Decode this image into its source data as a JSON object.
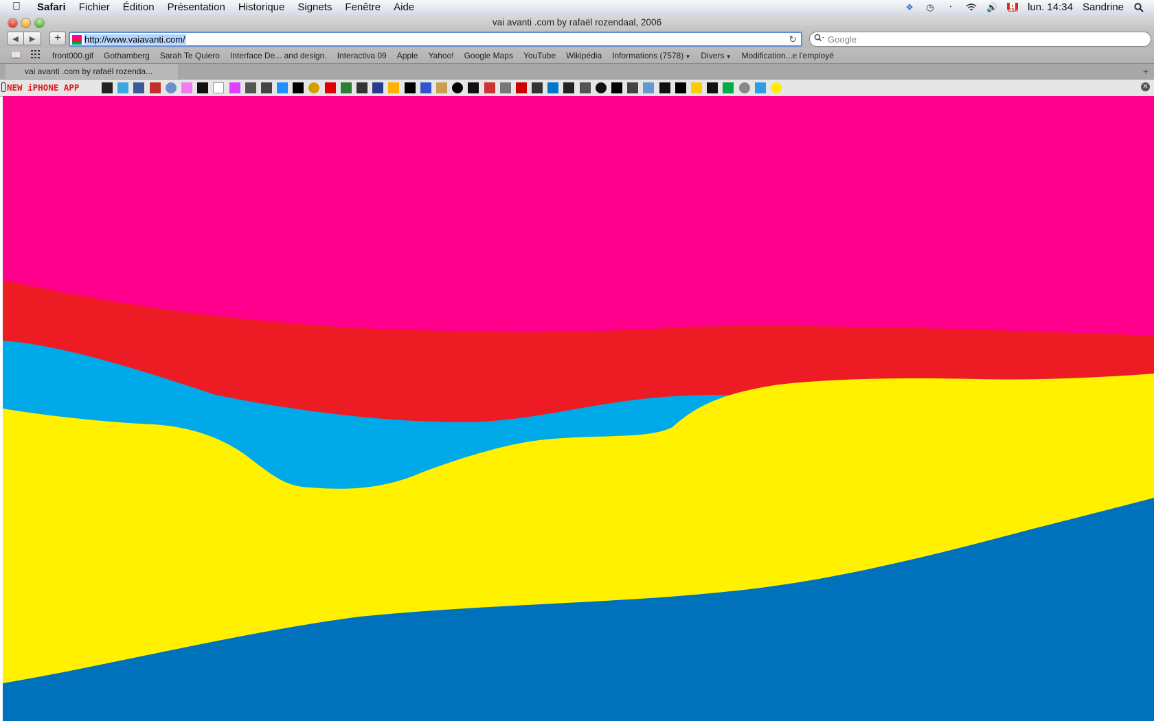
{
  "menubar": {
    "app": "Safari",
    "menus": [
      "Fichier",
      "Édition",
      "Présentation",
      "Historique",
      "Signets",
      "Fenêtre",
      "Aide"
    ],
    "clock": "lun. 14:34",
    "user": "Sandrine",
    "flag_text": "CSA"
  },
  "window": {
    "title": "vai avanti .com by rafaël rozendaal, 2006"
  },
  "toolbar": {
    "url": "http://www.vaiavanti.com/",
    "search_placeholder": "Google"
  },
  "bookmarks": {
    "items": [
      "front000.gif",
      "Gothamberg",
      "Sarah Te Quiero",
      "Interface De... and design.",
      "Interactiva 09",
      "Apple",
      "Yahoo!",
      "Google Maps",
      "YouTube",
      "Wikipédia",
      "Informations (7578)",
      "Divers",
      "Modification...e l'employé"
    ]
  },
  "tab": {
    "label": "vai avanti .com by rafaël rozenda..."
  },
  "extbar": {
    "label": "NEW iPHONE APP",
    "icon_colors": [
      "#222222",
      "#3ba7e0",
      "#3b5998",
      "#c4302b",
      "#6a8fc7",
      "#f07cf5",
      "#111111",
      "#ffffff",
      "#e040ff",
      "#555555",
      "#444444",
      "#1e90ff",
      "#000000",
      "#d4a000",
      "#e00000",
      "#2e7d32",
      "#333333",
      "#2a3a8f",
      "#ffb300",
      "#000000",
      "#3355cc",
      "#c8a050",
      "#000000",
      "#111111",
      "#cc3333",
      "#777777",
      "#cc0000",
      "#333333",
      "#0077cc",
      "#222222",
      "#555555",
      "#111111",
      "#000000",
      "#444444",
      "#6699cc",
      "#111111",
      "#000000",
      "#ffcc00",
      "#111111",
      "#00aa44",
      "#888888",
      "#2b9fe6",
      "#ffee00"
    ]
  },
  "content": {
    "colors": {
      "pink": "#ff008d",
      "red": "#ed1c24",
      "cyan": "#00a9e8",
      "yellow": "#fff100",
      "blue": "#0071bb"
    }
  }
}
